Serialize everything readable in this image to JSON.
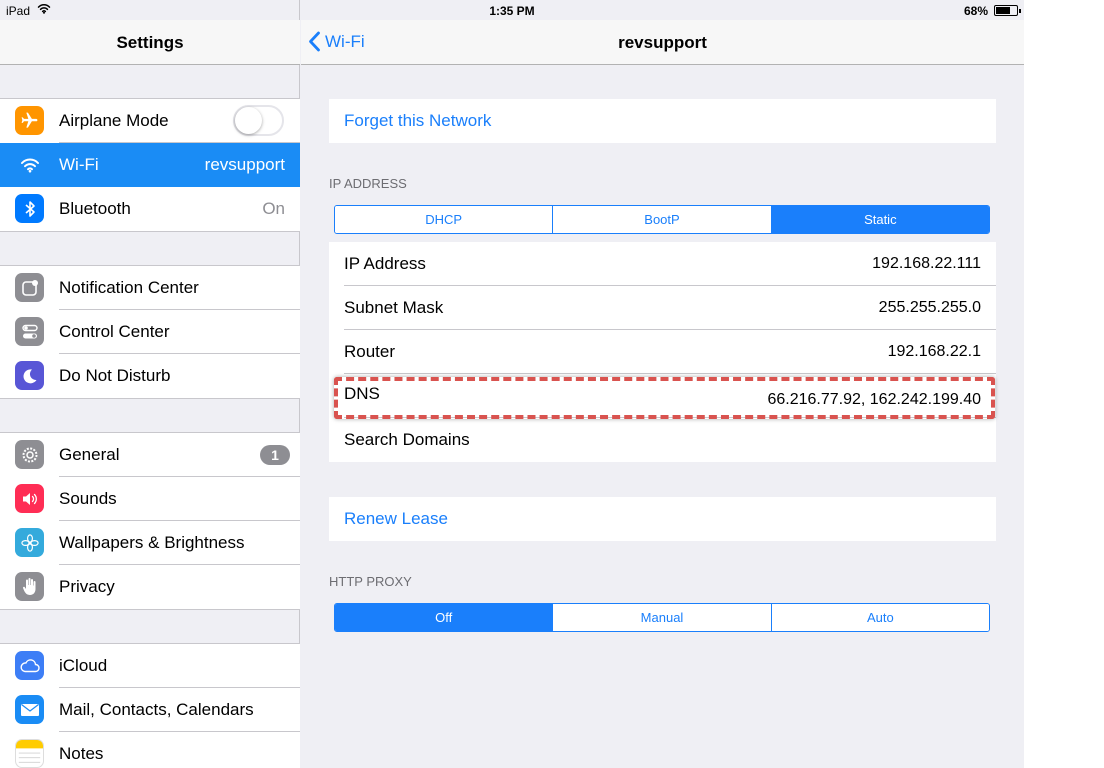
{
  "status_bar": {
    "device": "iPad",
    "time": "1:35 PM",
    "battery": "68%",
    "battery_level": 0.68
  },
  "sidebar": {
    "title": "Settings",
    "groups": [
      [
        {
          "label": "Airplane Mode",
          "icon": "airplane-icon",
          "color": "#ff9500",
          "toggle": "off"
        },
        {
          "label": "Wi-Fi",
          "detail": "revsupport",
          "icon": "wifi-icon",
          "color": "#007aff",
          "selected": true
        },
        {
          "label": "Bluetooth",
          "detail": "On",
          "icon": "bluetooth-icon",
          "color": "#007aff"
        }
      ],
      [
        {
          "label": "Notification Center",
          "icon": "notification-center-icon",
          "color": "#8e8e93"
        },
        {
          "label": "Control Center",
          "icon": "control-center-icon",
          "color": "#8e8e93"
        },
        {
          "label": "Do Not Disturb",
          "icon": "moon-icon",
          "color": "#5856d6"
        }
      ],
      [
        {
          "label": "General",
          "badge": "1",
          "icon": "gear-icon",
          "color": "#8e8e93"
        },
        {
          "label": "Sounds",
          "icon": "speaker-icon",
          "color": "#ff2d55"
        },
        {
          "label": "Wallpapers & Brightness",
          "icon": "flower-icon",
          "color": "#34aadc"
        },
        {
          "label": "Privacy",
          "icon": "hand-icon",
          "color": "#8e8e93"
        }
      ],
      [
        {
          "label": "iCloud",
          "icon": "cloud-icon",
          "color": "#3d7ef6"
        },
        {
          "label": "Mail, Contacts, Calendars",
          "icon": "mail-icon",
          "color": "#1a8cf5"
        },
        {
          "label": "Notes",
          "icon": "notes-icon",
          "color": "#ffcc00"
        }
      ]
    ]
  },
  "detail": {
    "back_label": "Wi-Fi",
    "title": "revsupport",
    "forget_label": "Forget this Network",
    "ip_header": "IP ADDRESS",
    "ip_modes": [
      "DHCP",
      "BootP",
      "Static"
    ],
    "ip_mode_selected": "Static",
    "fields": [
      {
        "label": "IP Address",
        "value": "192.168.22.111"
      },
      {
        "label": "Subnet Mask",
        "value": "255.255.255.0"
      },
      {
        "label": "Router",
        "value": "192.168.22.1"
      },
      {
        "label": "DNS",
        "value": "66.216.77.92, 162.242.199.40"
      },
      {
        "label": "Search Domains",
        "value": ""
      }
    ],
    "renew_label": "Renew Lease",
    "proxy_header": "HTTP PROXY",
    "proxy_modes": [
      "Off",
      "Manual",
      "Auto"
    ],
    "proxy_mode_selected": "Off"
  },
  "colors": {
    "accent": "#1a7ffb",
    "selection": "#1a8cf5",
    "highlight": "#d9534f"
  }
}
